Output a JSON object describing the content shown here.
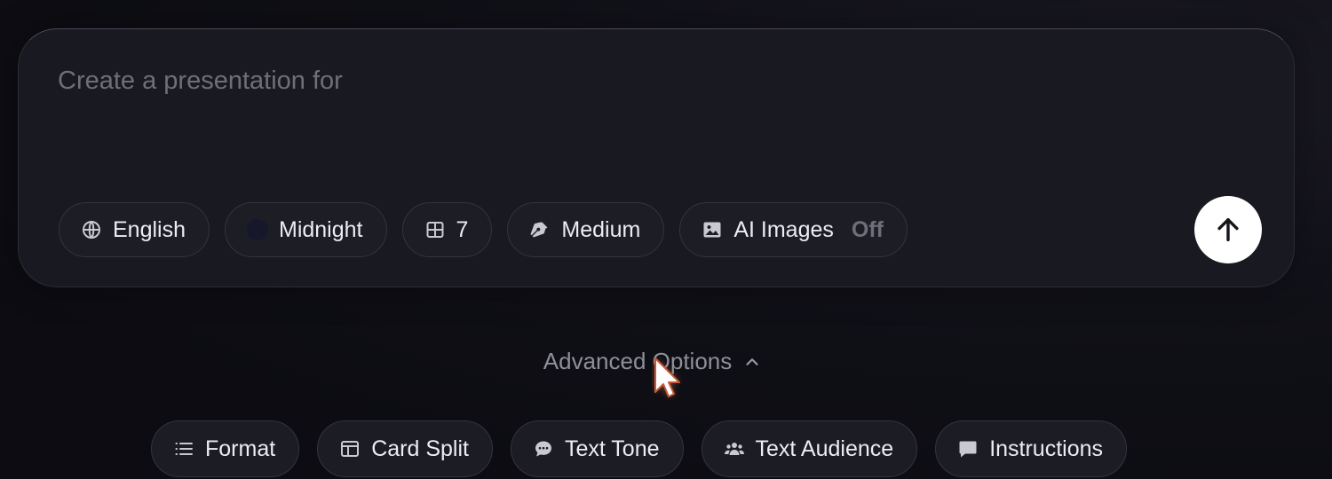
{
  "prompt": {
    "placeholder": "Create a presentation for",
    "value": ""
  },
  "chips": [
    {
      "label": "English",
      "icon": "globe-icon"
    },
    {
      "label": "Midnight",
      "icon": "theme-swatch"
    },
    {
      "label": "7",
      "icon": "grid-icon"
    },
    {
      "label": "Medium",
      "icon": "pen-nib-icon"
    },
    {
      "label": "AI Images",
      "icon": "image-icon",
      "status": "Off"
    }
  ],
  "send_button": {
    "icon": "arrow-up-icon"
  },
  "advanced": {
    "label": "Advanced Options",
    "icon": "chevron-up-icon"
  },
  "options": [
    {
      "label": "Format",
      "icon": "list-icon"
    },
    {
      "label": "Card Split",
      "icon": "layout-split-icon"
    },
    {
      "label": "Text Tone",
      "icon": "chat-dots-icon"
    },
    {
      "label": "Text Audience",
      "icon": "users-icon"
    },
    {
      "label": "Instructions",
      "icon": "message-square-icon"
    }
  ],
  "colors": {
    "background": "#0c0c12",
    "card": "#191922",
    "chip_border": "#34343f",
    "text": "#ececf1",
    "muted": "#8f8f99",
    "cursor_glow": "#f08050"
  }
}
